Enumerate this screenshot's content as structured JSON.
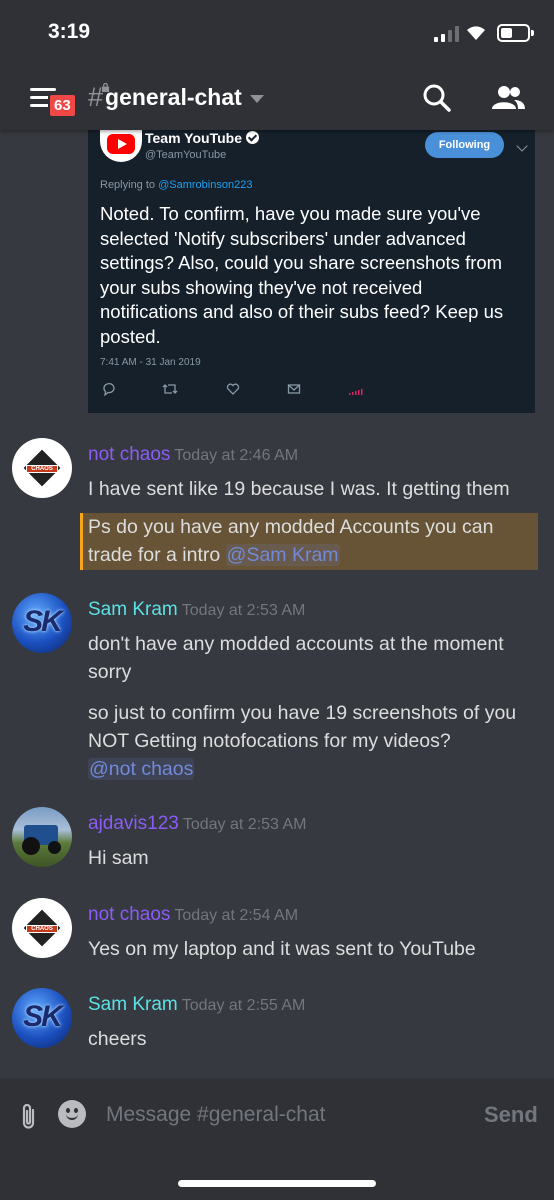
{
  "status_bar": {
    "time": "3:19"
  },
  "header": {
    "notification_count": "63",
    "channel_name": "general-chat"
  },
  "tweet": {
    "author": "Team YouTube",
    "handle": "@TeamYouTube",
    "follow_label": "Following",
    "replying_prefix": "Replying to",
    "replying_to": "@Samrobinson223",
    "text": "Noted. To confirm, have you made sure you've selected 'Notify subscribers' under advanced settings? Also, could you share screenshots from your subs showing they've not received notifications and also of their subs feed? Keep us posted.",
    "timestamp": "7:41 AM - 31 Jan 2019"
  },
  "messages": [
    {
      "username": "not chaos",
      "time": "Today at 2:46 AM",
      "lines": [
        "I have sent like 19 because I was. It getting them",
        "Ps do you have any modded Accounts you can trade for a intro"
      ],
      "mention": "@Sam Kram"
    },
    {
      "username": "Sam Kram",
      "time": "Today at 2:53 AM",
      "lines": [
        "don't have any modded accounts at the moment sorry",
        "so just to confirm you have 19 screenshots of you NOT Getting notofocations for my videos?"
      ],
      "mention": "@not chaos",
      "avatar_text": "SK"
    },
    {
      "username": "ajdavis123",
      "time": "Today at 2:53 AM",
      "lines": [
        "Hi sam"
      ]
    },
    {
      "username": "not chaos",
      "time": "Today at 2:54 AM",
      "lines": [
        "Yes on my laptop and it was sent to YouTube"
      ]
    },
    {
      "username": "Sam Kram",
      "time": "Today at 2:55 AM",
      "lines": [
        "cheers"
      ],
      "avatar_text": "SK"
    }
  ],
  "input": {
    "placeholder": "Message #general-chat",
    "send_label": "Send"
  },
  "colors": {
    "background": "#36393f",
    "header": "#2f3136",
    "username_purple": "#8b5cf6",
    "username_cyan": "#5ce1e6",
    "mention": "#7289da",
    "badge": "#f04747",
    "highlight_bar": "#faa61a"
  }
}
